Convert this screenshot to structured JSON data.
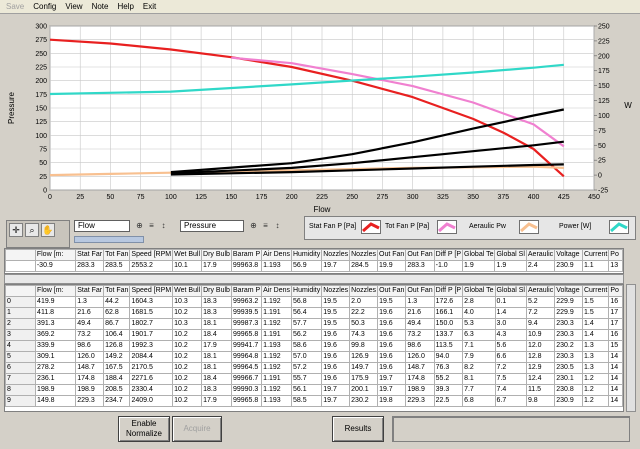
{
  "menu": {
    "items": [
      "Save",
      "Config",
      "View",
      "Note",
      "Help",
      "Exit"
    ],
    "disabled": [
      0
    ]
  },
  "chart_data": {
    "type": "line",
    "xlabel": "Flow",
    "ylabel": "Pressure",
    "y2label": "W",
    "xlim": [
      0,
      450
    ],
    "ylim": [
      0,
      300
    ],
    "y2lim": [
      -25,
      250
    ],
    "x_ticks": [
      0,
      25,
      50,
      75,
      100,
      125,
      150,
      175,
      200,
      225,
      250,
      275,
      300,
      325,
      350,
      375,
      400,
      425,
      450
    ],
    "y_ticks": [
      0,
      25,
      50,
      75,
      100,
      125,
      150,
      175,
      200,
      225,
      250,
      275,
      300
    ],
    "y2_ticks": [
      -25,
      0,
      25,
      50,
      75,
      100,
      125,
      150,
      175,
      200,
      225,
      250
    ],
    "grid": true,
    "series": [
      {
        "name": "Stat Fan P [Pa]",
        "color": "#e82020",
        "axis": "left",
        "points": [
          [
            0,
            275
          ],
          [
            50,
            268
          ],
          [
            100,
            257
          ],
          [
            150,
            243
          ],
          [
            200,
            225
          ],
          [
            250,
            200
          ],
          [
            300,
            170
          ],
          [
            350,
            130
          ],
          [
            375,
            105
          ],
          [
            400,
            75
          ],
          [
            425,
            25
          ]
        ]
      },
      {
        "name": "Tot Fan P [Pa]",
        "color": "#f080d0",
        "axis": "left",
        "points": [
          [
            150,
            242
          ],
          [
            200,
            232
          ],
          [
            250,
            212
          ],
          [
            300,
            190
          ],
          [
            350,
            160
          ],
          [
            400,
            120
          ],
          [
            425,
            80
          ]
        ]
      },
      {
        "name": "Aeraulic Pw",
        "color": "#f8c090",
        "axis": "right",
        "points": [
          [
            0,
            0
          ],
          [
            50,
            2
          ],
          [
            100,
            4
          ],
          [
            150,
            6
          ],
          [
            200,
            8
          ],
          [
            250,
            10
          ],
          [
            300,
            12
          ],
          [
            350,
            13
          ],
          [
            400,
            14
          ],
          [
            425,
            12
          ]
        ]
      },
      {
        "name": "Power [W]",
        "color": "#30d8c8",
        "axis": "right",
        "points": [
          [
            0,
            136
          ],
          [
            100,
            140
          ],
          [
            200,
            152
          ],
          [
            300,
            165
          ],
          [
            350,
            172
          ],
          [
            400,
            180
          ],
          [
            425,
            185
          ]
        ]
      },
      {
        "name": "",
        "color": "#000000",
        "axis": "right",
        "points": [
          [
            100,
            5
          ],
          [
            200,
            20
          ],
          [
            250,
            35
          ],
          [
            300,
            55
          ],
          [
            350,
            78
          ],
          [
            400,
            100
          ],
          [
            425,
            110
          ]
        ]
      },
      {
        "name": "",
        "color": "#000000",
        "axis": "right",
        "points": [
          [
            100,
            3
          ],
          [
            200,
            12
          ],
          [
            250,
            20
          ],
          [
            300,
            30
          ],
          [
            350,
            40
          ],
          [
            400,
            50
          ],
          [
            425,
            56
          ]
        ]
      },
      {
        "name": "",
        "color": "#000000",
        "axis": "right",
        "points": [
          [
            100,
            1
          ],
          [
            200,
            5
          ],
          [
            250,
            8
          ],
          [
            300,
            11
          ],
          [
            350,
            14
          ],
          [
            400,
            17
          ],
          [
            425,
            18
          ]
        ]
      }
    ]
  },
  "plot_selectors": {
    "x": "Flow",
    "y": "Pressure"
  },
  "legend": [
    {
      "label": "Stat Fan P [Pa]",
      "color": "#e82020"
    },
    {
      "label": "Tot Fan P [Pa]",
      "color": "#f080d0"
    },
    {
      "label": "Aeraulic Pw",
      "color": "#f8c090"
    },
    {
      "label": "Power [W]",
      "color": "#30d8c8"
    }
  ],
  "columns": [
    "Flow [m:",
    "Stat Far",
    "Tot Fan",
    "Speed [RPM",
    "Wet Bull",
    "Dry Bulb",
    "Baram P",
    "Air Dens",
    "Humidity",
    "Nozzles",
    "Nozzles",
    "Out Fan",
    "Out Fan",
    "Diff P [P",
    "Global Te",
    "Global Sl",
    "Aeraulic",
    "Voltage",
    "Current",
    "Po"
  ],
  "current_row": [
    "-30.9",
    "283.3",
    "283.5",
    "2553.2",
    "10.1",
    "17.9",
    "99963.8",
    "1.193",
    "56.9",
    "19.7",
    "284.5",
    "19.9",
    "283.3",
    "-1.0",
    "1.9",
    "1.9",
    "2.4",
    "230.9",
    "1.1",
    "13"
  ],
  "rows": [
    [
      "0",
      "419.9",
      "1.3",
      "44.2",
      "1604.3",
      "10.3",
      "18.3",
      "99963.2",
      "1.192",
      "56.8",
      "19.5",
      "2.0",
      "19.5",
      "1.3",
      "172.6",
      "2.8",
      "0.1",
      "5.2",
      "229.9",
      "1.5",
      "16"
    ],
    [
      "1",
      "411.8",
      "21.6",
      "62.8",
      "1681.5",
      "10.2",
      "18.3",
      "99939.5",
      "1.191",
      "56.4",
      "19.5",
      "22.2",
      "19.6",
      "21.6",
      "166.1",
      "4.0",
      "1.4",
      "7.2",
      "229.9",
      "1.5",
      "17"
    ],
    [
      "2",
      "391.3",
      "49.4",
      "86.7",
      "1802.7",
      "10.3",
      "18.1",
      "99987.3",
      "1.192",
      "57.7",
      "19.5",
      "50.3",
      "19.6",
      "49.4",
      "150.0",
      "5.3",
      "3.0",
      "9.4",
      "230.3",
      "1.4",
      "17"
    ],
    [
      "3",
      "369.2",
      "73.2",
      "106.4",
      "1901.7",
      "10.2",
      "18.4",
      "99965.8",
      "1.191",
      "56.2",
      "19.6",
      "74.3",
      "19.6",
      "73.2",
      "133.7",
      "6.3",
      "4.3",
      "10.9",
      "230.3",
      "1.4",
      "16"
    ],
    [
      "4",
      "339.9",
      "98.6",
      "126.8",
      "1992.3",
      "10.2",
      "17.9",
      "99941.7",
      "1.193",
      "58.6",
      "19.6",
      "99.8",
      "19.6",
      "98.6",
      "113.5",
      "7.1",
      "5.6",
      "12.0",
      "230.2",
      "1.3",
      "15"
    ],
    [
      "5",
      "309.1",
      "126.0",
      "149.2",
      "2084.4",
      "10.2",
      "18.1",
      "99964.8",
      "1.192",
      "57.0",
      "19.6",
      "126.9",
      "19.6",
      "126.0",
      "94.0",
      "7.9",
      "6.6",
      "12.8",
      "230.3",
      "1.3",
      "14"
    ],
    [
      "6",
      "278.2",
      "148.7",
      "167.5",
      "2170.5",
      "10.2",
      "18.1",
      "99964.5",
      "1.192",
      "57.2",
      "19.6",
      "149.7",
      "19.6",
      "148.7",
      "76.3",
      "8.2",
      "7.2",
      "12.9",
      "230.5",
      "1.3",
      "14"
    ],
    [
      "7",
      "236.1",
      "174.8",
      "188.4",
      "2271.6",
      "10.2",
      "18.4",
      "99966.7",
      "1.191",
      "55.7",
      "19.6",
      "175.9",
      "19.7",
      "174.8",
      "55.2",
      "8.1",
      "7.5",
      "12.4",
      "230.1",
      "1.2",
      "14"
    ],
    [
      "8",
      "198.9",
      "198.9",
      "208.5",
      "2330.4",
      "10.2",
      "18.3",
      "99990.3",
      "1.192",
      "56.1",
      "19.7",
      "200.1",
      "19.7",
      "198.9",
      "39.3",
      "7.7",
      "7.4",
      "11.5",
      "230.8",
      "1.2",
      "14"
    ],
    [
      "9",
      "149.8",
      "229.3",
      "234.7",
      "2409.0",
      "10.2",
      "17.9",
      "99965.8",
      "1.193",
      "58.5",
      "19.7",
      "230.2",
      "19.8",
      "229.3",
      "22.5",
      "6.8",
      "6.7",
      "9.8",
      "230.9",
      "1.2",
      "14"
    ]
  ],
  "buttons": {
    "normalize": "Enable Normalize",
    "acquire": "Acquire",
    "results": "Results"
  }
}
